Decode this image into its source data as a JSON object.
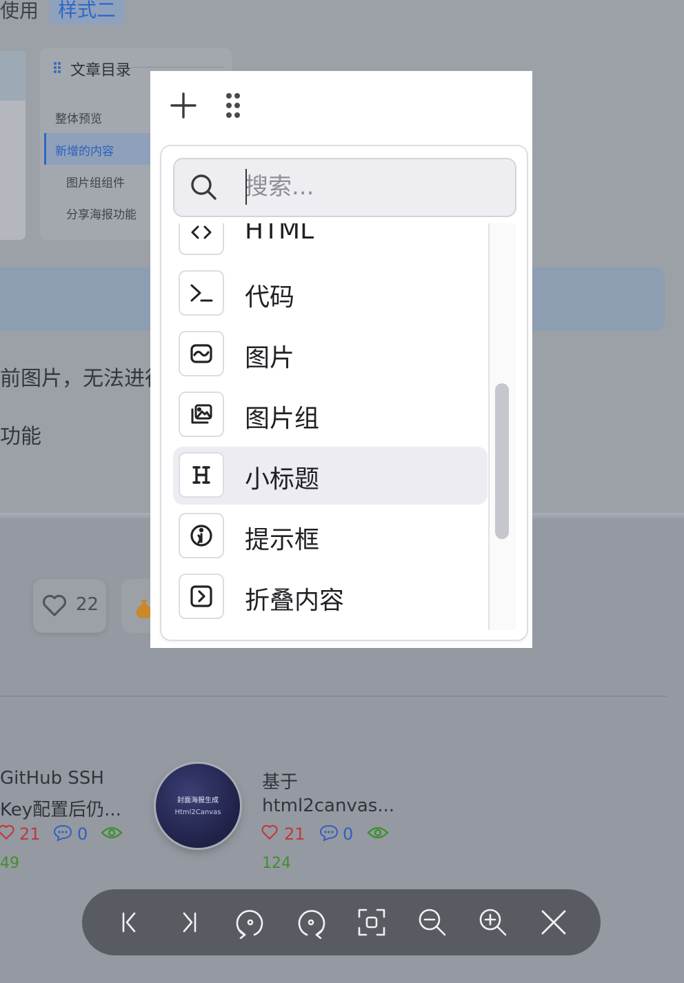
{
  "background": {
    "usage_label": "使用",
    "style_chip": "样式二",
    "toc": {
      "title": "文章目录",
      "items": [
        "整体预览",
        "新增的内容",
        "图片组组件",
        "分享海报功能"
      ]
    },
    "paragraph1": "前图片，无法进行",
    "paragraph2": "功能",
    "like_count": "22",
    "posts": [
      {
        "title_line1": "GitHub SSH",
        "title_line2": "Key配置后仍...",
        "likes": "21",
        "comments": "0",
        "views": "49"
      },
      {
        "thumb_line1": "封面海报生成",
        "thumb_line2": "Html2Canvas",
        "title_line1": "基于",
        "title_line2": "html2canvas...",
        "likes": "21",
        "comments": "0",
        "views": "124"
      }
    ]
  },
  "popup": {
    "add_icon": "plus-icon",
    "drag_icon": "drag-handle-icon",
    "search": {
      "placeholder": "搜索...",
      "value": ""
    },
    "items": [
      {
        "label": "HTML",
        "icon": "code-brackets-icon"
      },
      {
        "label": "代码",
        "icon": "terminal-icon"
      },
      {
        "label": "图片",
        "icon": "image-icon"
      },
      {
        "label": "图片组",
        "icon": "image-group-icon"
      },
      {
        "label": "小标题",
        "icon": "heading-icon",
        "active": true
      },
      {
        "label": "提示框",
        "icon": "info-icon"
      },
      {
        "label": "折叠内容",
        "icon": "collapse-icon"
      }
    ]
  },
  "toolbar": {
    "buttons": [
      "first-page-icon",
      "last-page-icon",
      "rotate-left-icon",
      "rotate-right-icon",
      "fit-screen-icon",
      "zoom-out-icon",
      "zoom-in-icon",
      "close-icon"
    ]
  },
  "colors": {
    "accent_blue": "#3266c2",
    "like_red": "#c0393b",
    "view_green": "#3f8f2c",
    "toolbar_bg": "#585c62",
    "active_item_bg": "#ececf2"
  }
}
